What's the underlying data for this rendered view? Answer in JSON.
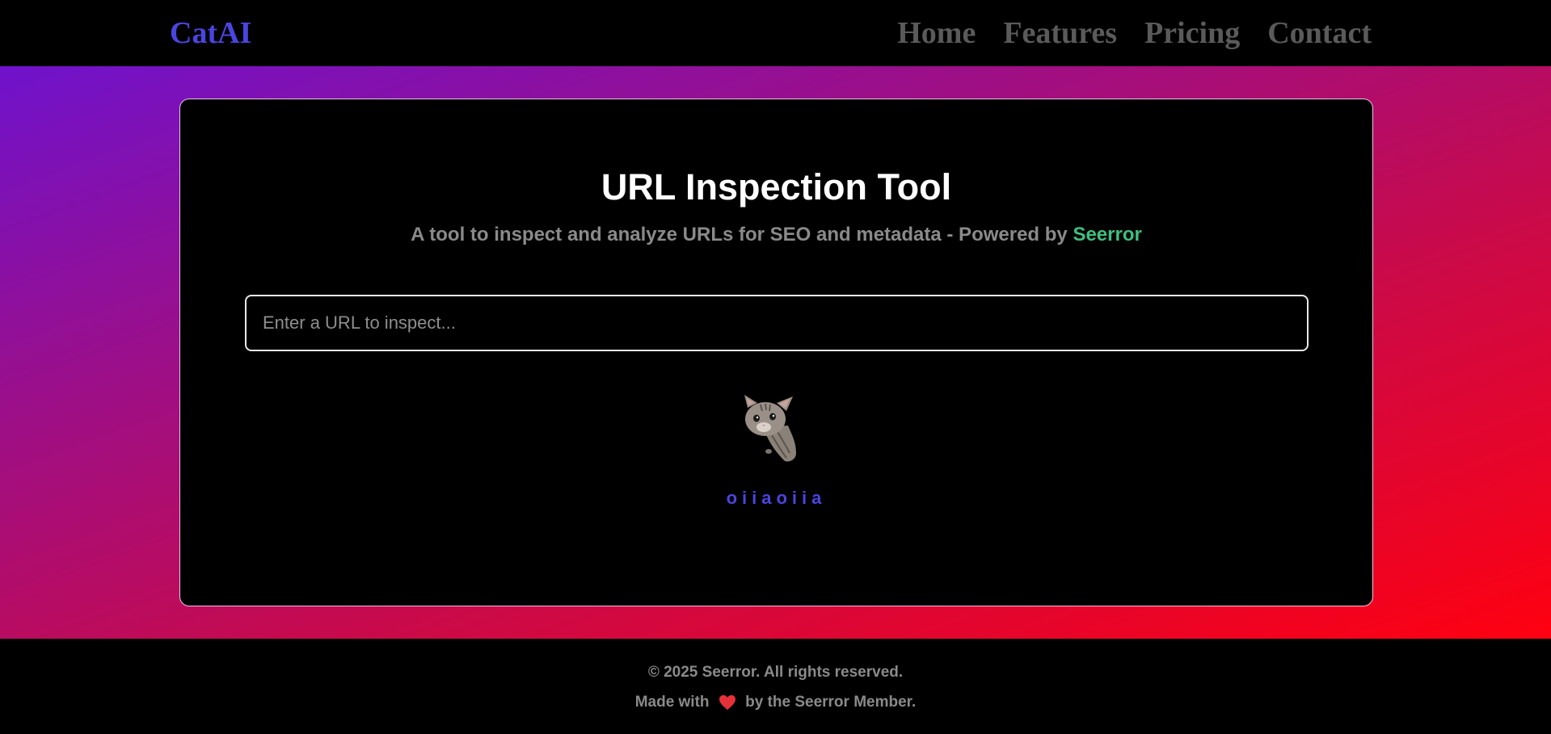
{
  "header": {
    "brand": "CatAI",
    "nav": [
      "Home",
      "Features",
      "Pricing",
      "Contact"
    ]
  },
  "main": {
    "title": "URL Inspection Tool",
    "subtitle_prefix": "A tool to inspect and analyze URLs for SEO and metadata - Powered by ",
    "subtitle_link": "Seerror",
    "input_placeholder": "Enter a URL to inspect...",
    "input_value": "",
    "cat_label": "oiiaoiia"
  },
  "footer": {
    "copyright": "© 2025 Seerror. All rights reserved.",
    "made_with_prefix": "Made with",
    "made_with_suffix": "by the Seerror Member."
  },
  "colors": {
    "brand": "#4a45e0",
    "nav_text": "#5a5a5a",
    "link_green": "#3fbf7f",
    "gradient_start": "#6f12cc",
    "gradient_end": "#ff0010",
    "heart": "#e8303a"
  },
  "icons": {
    "cat": "cat-image",
    "heart": "heart-icon"
  }
}
